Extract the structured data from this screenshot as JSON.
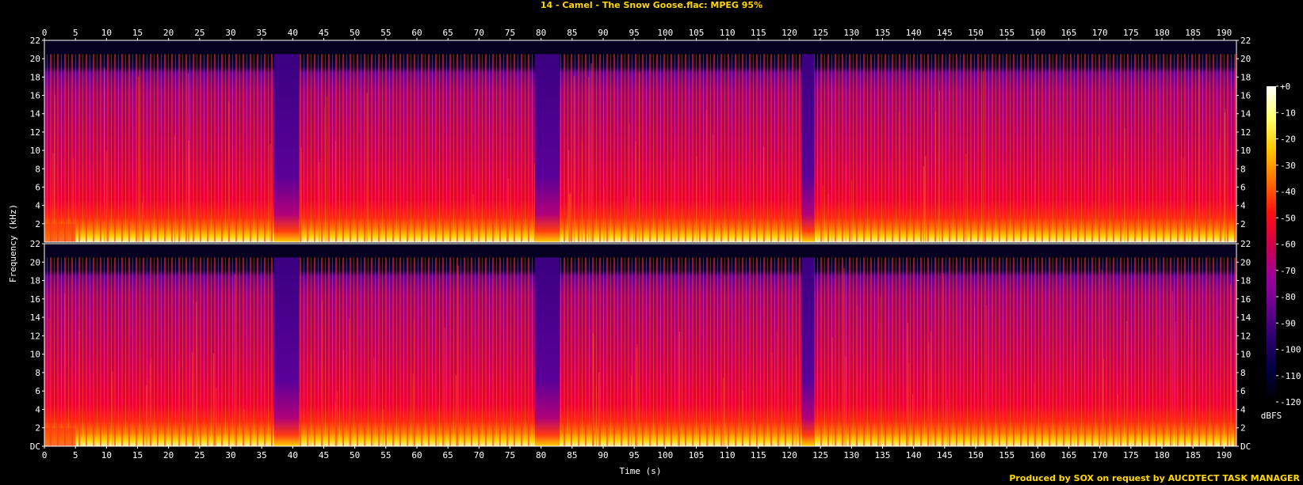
{
  "title": "14 - Camel - The Snow Goose.flac: MPEG 95%",
  "footer": "Produced by SOX on request by AUCDTECT TASK MANAGER",
  "chart_data": {
    "type": "heatmap",
    "title": "14 - Camel - The Snow Goose.flac: MPEG 95%",
    "xlabel": "Time (s)",
    "ylabel": "Frequency (kHz)",
    "x_ticks": [
      0,
      5,
      10,
      15,
      20,
      25,
      30,
      35,
      40,
      45,
      50,
      55,
      60,
      65,
      70,
      75,
      80,
      85,
      90,
      95,
      100,
      105,
      110,
      115,
      120,
      125,
      130,
      135,
      140,
      145,
      150,
      155,
      160,
      165,
      170,
      175,
      180,
      185,
      190
    ],
    "xlim": [
      0,
      192
    ],
    "y_ticks": [
      "DC",
      "2",
      "4",
      "6",
      "8",
      "10",
      "12",
      "14",
      "16",
      "18",
      "20",
      "22"
    ],
    "ylim": [
      0,
      22
    ],
    "channels": 2,
    "lowpass_cutoff_khz": 20.5,
    "quiet_segments_s": [
      [
        37,
        41
      ],
      [
        79,
        83
      ],
      [
        122,
        124
      ]
    ],
    "colorbar": {
      "label": "dBFS",
      "ticks": [
        "+0",
        "-10",
        "-20",
        "-30",
        "-40",
        "-50",
        "-60",
        "-70",
        "-80",
        "-90",
        "-100",
        "-110",
        "-120"
      ],
      "range": [
        -120,
        0
      ],
      "colors": [
        "#000000",
        "#000040",
        "#2a0070",
        "#6a0090",
        "#a0009a",
        "#d0004a",
        "#ff1010",
        "#ff7000",
        "#ffc800",
        "#ffff70",
        "#ffffff"
      ]
    }
  }
}
